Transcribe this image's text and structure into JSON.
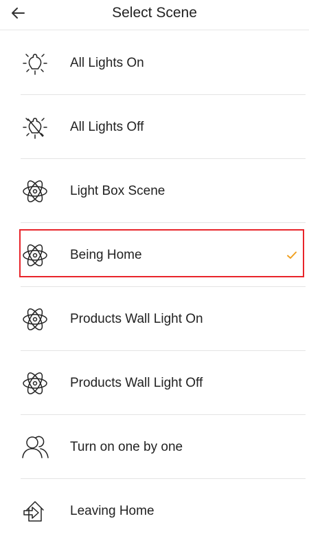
{
  "header": {
    "title": "Select Scene",
    "back_icon": "arrow-left-icon"
  },
  "colors": {
    "check": "#f0a020",
    "highlight": "#e8242a",
    "separator": "#e3e3e3",
    "text": "#222222"
  },
  "scenes": [
    {
      "label": "All Lights On",
      "icon": "bulb-on-icon",
      "selected": false
    },
    {
      "label": "All Lights Off",
      "icon": "bulb-off-icon",
      "selected": false
    },
    {
      "label": "Light Box Scene",
      "icon": "atom-icon",
      "selected": false
    },
    {
      "label": "Being Home",
      "icon": "atom-icon",
      "selected": true
    },
    {
      "label": "Products Wall Light On",
      "icon": "atom-icon",
      "selected": false
    },
    {
      "label": "Products Wall Light Off",
      "icon": "atom-icon",
      "selected": false
    },
    {
      "label": "Turn on one by one",
      "icon": "users-icon",
      "selected": false
    },
    {
      "label": "Leaving Home",
      "icon": "house-exit-icon",
      "selected": false
    }
  ]
}
